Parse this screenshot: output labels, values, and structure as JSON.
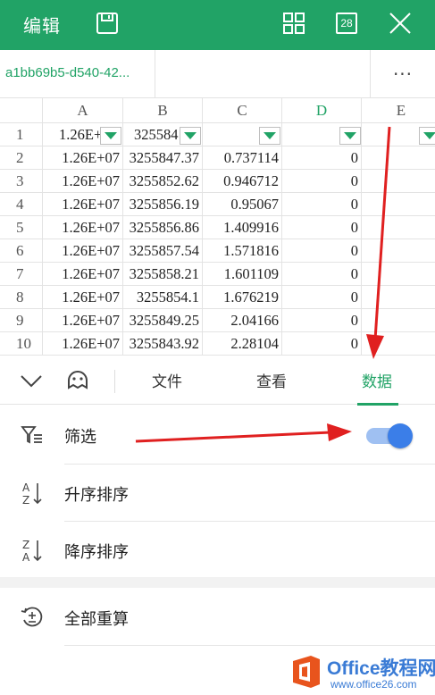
{
  "header": {
    "edit_label": "编辑",
    "badge_number": "28",
    "icons": [
      "save-icon",
      "grid-icon",
      "badge-icon",
      "close-icon"
    ]
  },
  "sheet_tab": {
    "name": "a1bb69b5-d540-42...",
    "more_label": "···"
  },
  "spreadsheet": {
    "columns": [
      "A",
      "B",
      "C",
      "D",
      "E"
    ],
    "rows": [
      [
        "1",
        "1.26E+",
        "325584",
        "",
        "",
        ""
      ],
      [
        "2",
        "1.26E+07",
        "3255847.37",
        "0.737114",
        "0",
        ""
      ],
      [
        "3",
        "1.26E+07",
        "3255852.62",
        "0.946712",
        "0",
        ""
      ],
      [
        "4",
        "1.26E+07",
        "3255856.19",
        "0.95067",
        "0",
        ""
      ],
      [
        "5",
        "1.26E+07",
        "3255856.86",
        "1.409916",
        "0",
        ""
      ],
      [
        "6",
        "1.26E+07",
        "3255857.54",
        "1.571816",
        "0",
        ""
      ],
      [
        "7",
        "1.26E+07",
        "3255858.21",
        "1.601109",
        "0",
        ""
      ],
      [
        "8",
        "1.26E+07",
        "3255854.1",
        "1.676219",
        "0",
        ""
      ],
      [
        "9",
        "1.26E+07",
        "3255849.25",
        "2.04166",
        "0",
        ""
      ],
      [
        "10",
        "1.26E+07",
        "3255843.92",
        "2.28104",
        "0",
        ""
      ]
    ]
  },
  "panel": {
    "tabs": [
      {
        "label": "文件",
        "active": false
      },
      {
        "label": "查看",
        "active": false
      },
      {
        "label": "数据",
        "active": true
      }
    ],
    "menu": [
      {
        "label": "筛选",
        "icon": "filter-icon",
        "toggle_on": true
      },
      {
        "label": "升序排序",
        "icon": "sort-ascending-icon"
      },
      {
        "label": "降序排序",
        "icon": "sort-descending-icon"
      },
      {
        "label": "全部重算",
        "icon": "recalculate-icon"
      }
    ]
  },
  "watermark": {
    "title": "Office教程网",
    "url": "www.office26.com"
  },
  "colors": {
    "accent": "#21a366",
    "toggle": "#3b7ee8",
    "arrow": "#e02020"
  }
}
